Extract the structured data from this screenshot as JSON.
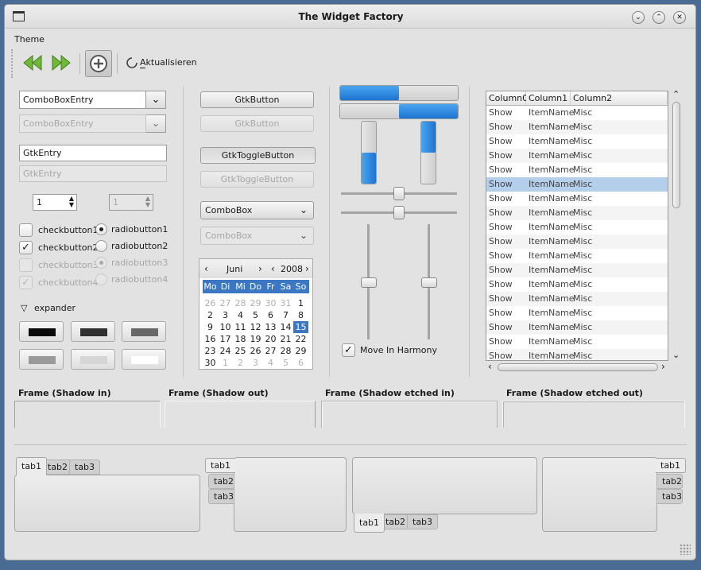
{
  "window": {
    "title": "The Widget Factory"
  },
  "menu": [
    "Theme"
  ],
  "toolbar": {
    "refresh_label": "Aktualisieren"
  },
  "col1": {
    "combo_entry": "ComboBoxEntry",
    "combo_entry_disabled": "ComboBoxEntry",
    "entry": "GtkEntry",
    "entry_disabled": "GtkEntry",
    "spin": "1",
    "spin_disabled": "1",
    "check1": "checkbutton1",
    "check2": "checkbutton2",
    "check3": "checkbutton3",
    "check4": "checkbutton4",
    "radio1": "radiobutton1",
    "radio2": "radiobutton2",
    "radio3": "radiobutton3",
    "radio4": "radiobutton4",
    "expander": "expander",
    "swatches": [
      "#0a0a0a",
      "#303030",
      "#686868",
      "#9a9a9a",
      "#d6d6d6",
      "#ffffff"
    ]
  },
  "col2": {
    "button": "GtkButton",
    "button_disabled": "GtkButton",
    "toggle": "GtkToggleButton",
    "toggle_disabled": "GtkToggleButton",
    "combo": "ComboBox",
    "combo_disabled": "ComboBox",
    "calendar": {
      "month": "Juni",
      "year": "2008",
      "weekdays": [
        "Mo",
        "Di",
        "Mi",
        "Do",
        "Fr",
        "Sa",
        "So"
      ],
      "days": [
        "26",
        "27",
        "28",
        "29",
        "30",
        "31",
        "1",
        "2",
        "3",
        "4",
        "5",
        "6",
        "7",
        "8",
        "9",
        "10",
        "11",
        "12",
        "13",
        "14",
        "15",
        "16",
        "17",
        "18",
        "19",
        "20",
        "21",
        "22",
        "23",
        "24",
        "25",
        "26",
        "27",
        "28",
        "29",
        "30",
        "1",
        "2",
        "3",
        "4",
        "5",
        "6"
      ],
      "selected": "15"
    }
  },
  "col3": {
    "progress": [
      0.5,
      0.5
    ],
    "vprogress": [
      0.5,
      0.5
    ],
    "sliders": [
      0.5,
      0.5
    ],
    "vsliders": [
      0.5,
      0.5
    ],
    "harmony": "Move In Harmony"
  },
  "tree": {
    "columns": [
      "Column0",
      "Column1",
      "Column2"
    ],
    "rows": [
      [
        "Show",
        "ItemName",
        "Misc"
      ],
      [
        "Show",
        "ItemName",
        "Misc"
      ],
      [
        "Show",
        "ItemName",
        "Misc"
      ],
      [
        "Show",
        "ItemName",
        "Misc"
      ],
      [
        "Show",
        "ItemName",
        "Misc"
      ],
      [
        "Show",
        "ItemName",
        "Misc"
      ],
      [
        "Show",
        "ItemName",
        "Misc"
      ],
      [
        "Show",
        "ItemName",
        "Misc"
      ],
      [
        "Show",
        "ItemName",
        "Misc"
      ],
      [
        "Show",
        "ItemName",
        "Misc"
      ],
      [
        "Show",
        "ItemName",
        "Misc"
      ],
      [
        "Show",
        "ItemName",
        "Misc"
      ],
      [
        "Show",
        "ItemName",
        "Misc"
      ],
      [
        "Show",
        "ItemName",
        "Misc"
      ],
      [
        "Show",
        "ItemName",
        "Misc"
      ],
      [
        "Show",
        "ItemName",
        "Misc"
      ],
      [
        "Show",
        "ItemName",
        "Misc"
      ],
      [
        "Show",
        "ItemName",
        "Misc"
      ]
    ],
    "selected_row": 5
  },
  "frames": [
    "Frame (Shadow in)",
    "Frame (Shadow out)",
    "Frame (Shadow etched in)",
    "Frame (Shadow etched out)"
  ],
  "tabs": [
    "tab1",
    "tab2",
    "tab3"
  ],
  "colors": {
    "accent": "#3b77c3",
    "selection": "#b4cfeb",
    "progress": "#2a86e0"
  }
}
